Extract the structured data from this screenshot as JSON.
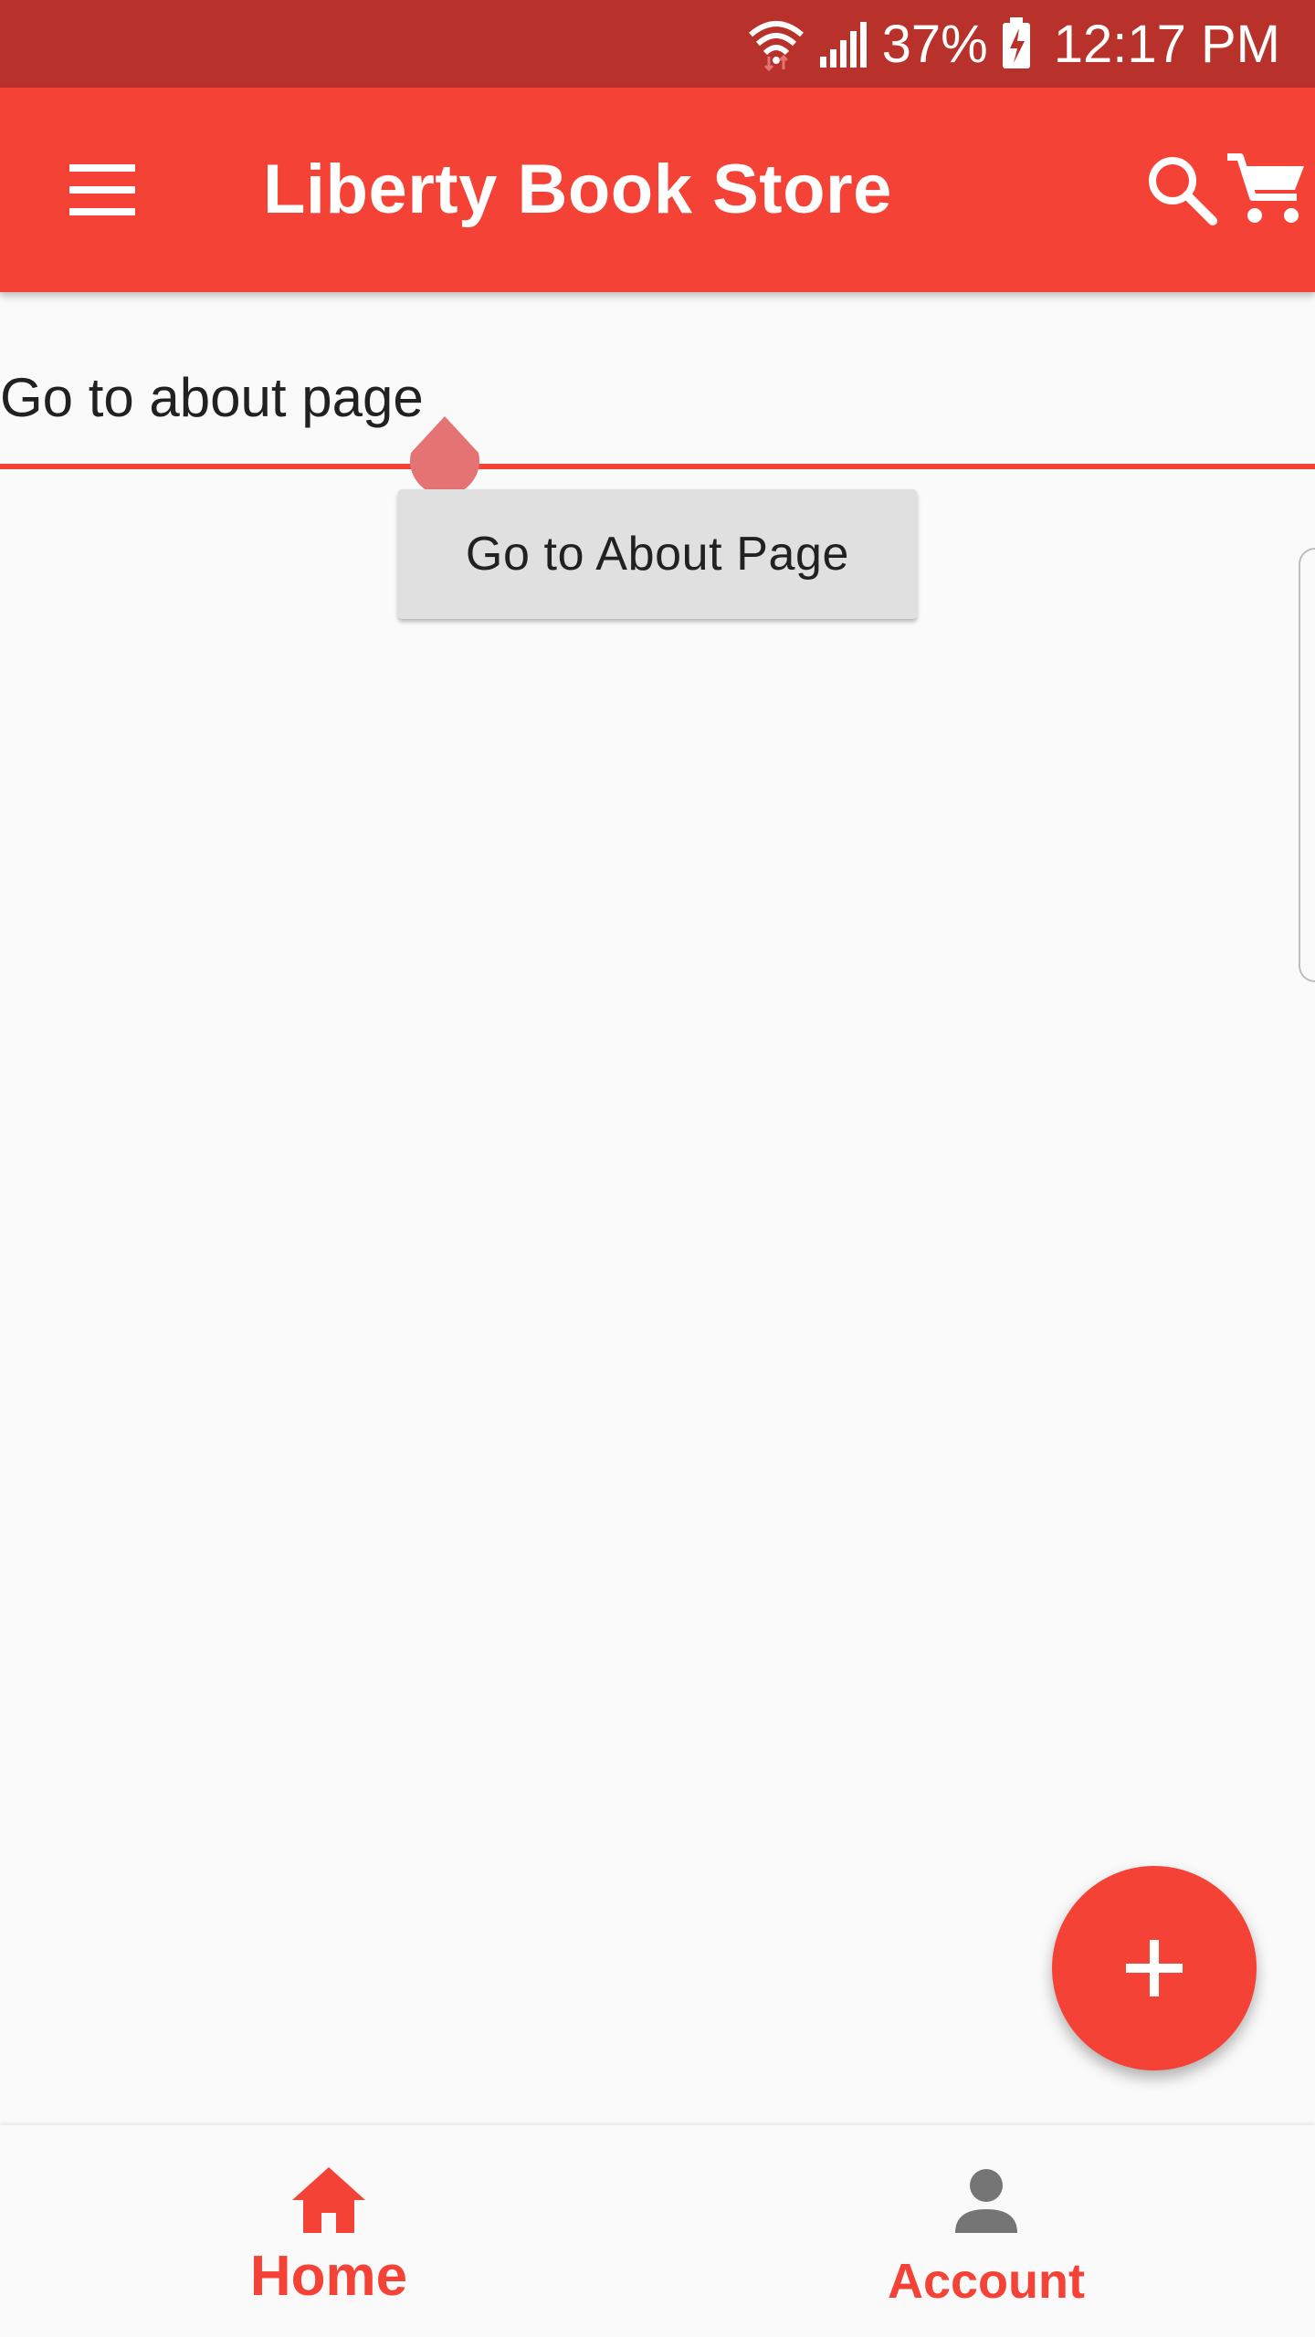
{
  "status_bar": {
    "battery_percent": "37%",
    "time": "12:17 PM"
  },
  "app_bar": {
    "title": "Liberty Book Store",
    "menu_icon": "menu-icon",
    "search_icon": "search-icon",
    "cart_icon": "cart-icon"
  },
  "text_field": {
    "value": "Go to about page",
    "placeholder": ""
  },
  "button": {
    "label": "Go to About Page"
  },
  "fab": {
    "icon": "plus-icon"
  },
  "bottom_nav": {
    "items": [
      {
        "label": "Home",
        "icon": "home-icon",
        "active": true
      },
      {
        "label": "Account",
        "icon": "person-icon",
        "active": false
      }
    ]
  },
  "colors": {
    "status_bar": "#b8312a",
    "primary": "#f44336",
    "background": "#fafafa",
    "button": "#e0e0e0",
    "inactive_icon": "#757575"
  }
}
